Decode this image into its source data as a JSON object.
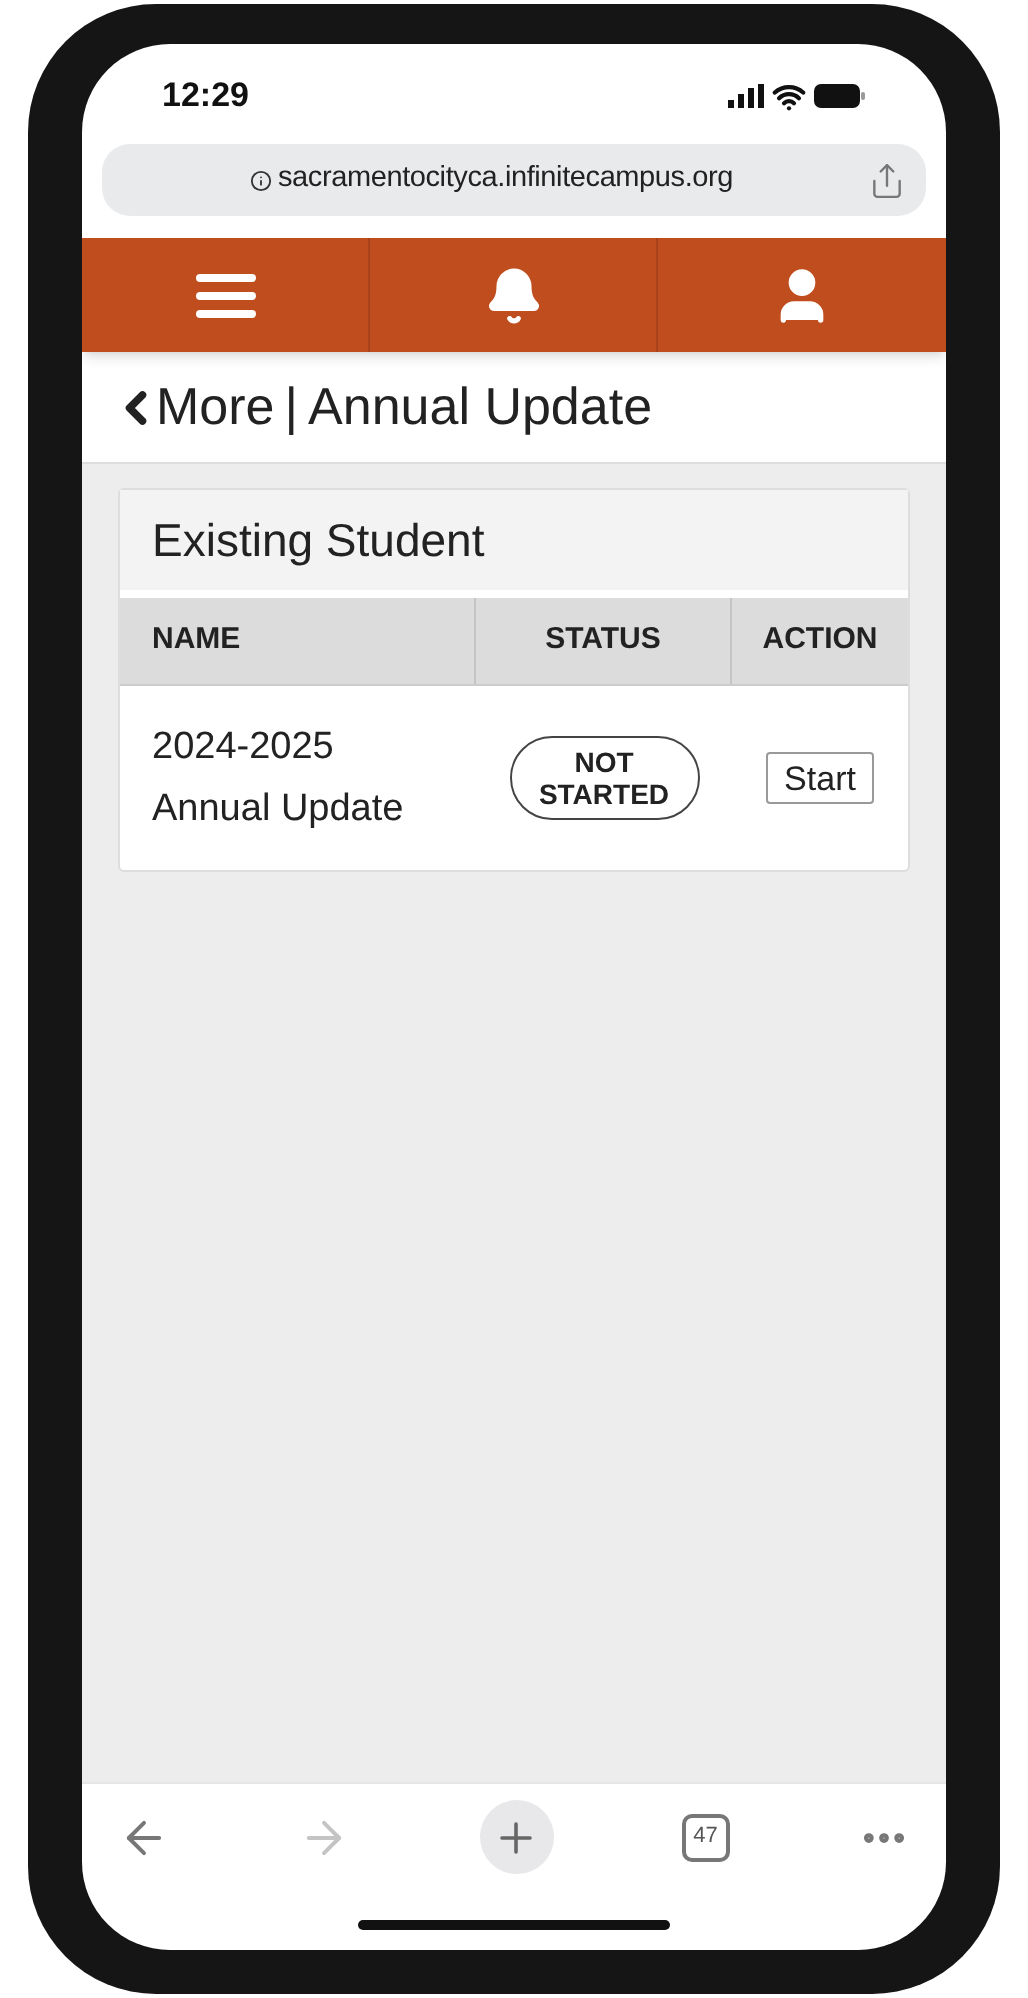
{
  "status_bar": {
    "time": "12:29"
  },
  "url_bar": {
    "address": "sacramentocityca.infinitecampus.org"
  },
  "page": {
    "back_label": "More",
    "separator": "|",
    "title": "Annual Update"
  },
  "card": {
    "title": "Existing Student",
    "table": {
      "columns": [
        "NAME",
        "STATUS",
        "ACTION"
      ],
      "rows": [
        {
          "name": "2024-2025 Annual Update",
          "status": "NOT STARTED",
          "action": "Start"
        }
      ]
    }
  },
  "browser_toolbar": {
    "back": {
      "disabled": false
    },
    "forward": {
      "disabled": true
    },
    "tab_count": "47"
  }
}
